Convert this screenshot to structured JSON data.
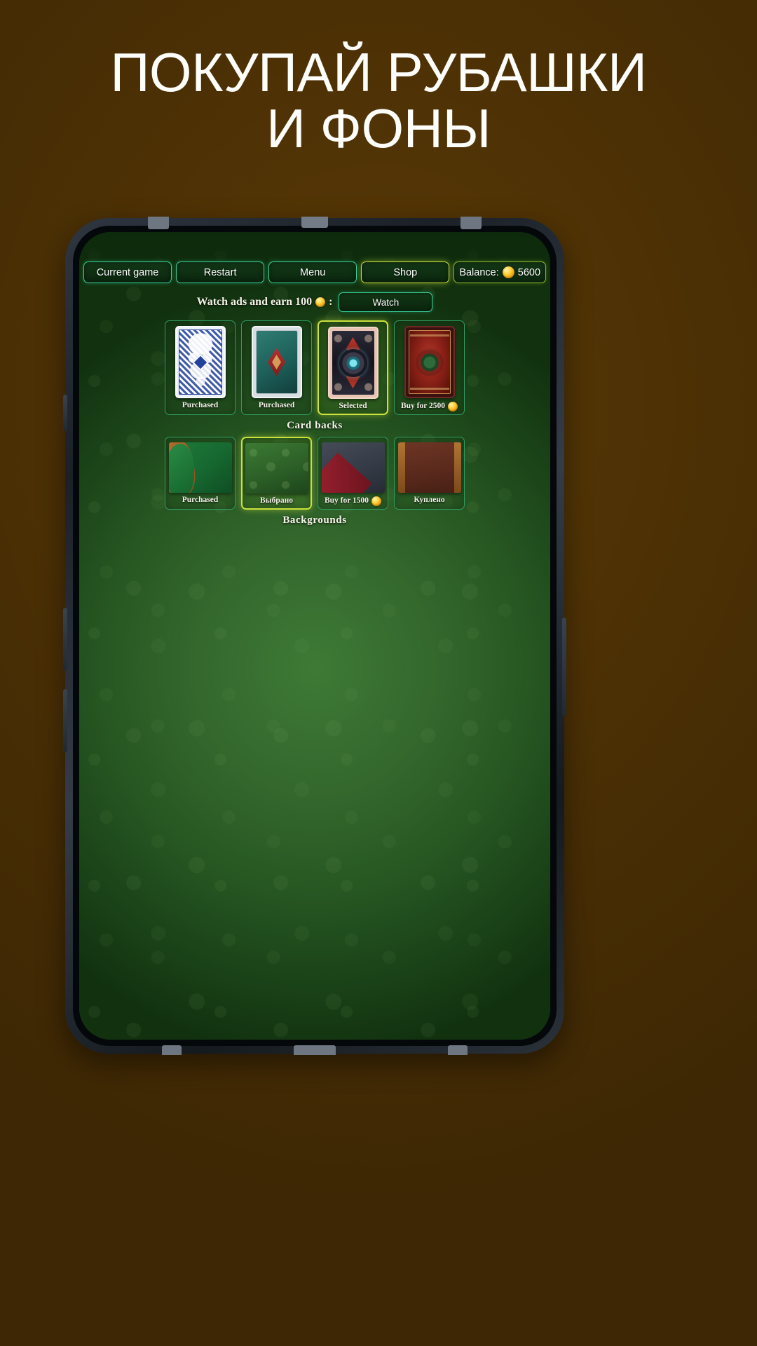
{
  "promo": {
    "headline": "ПОКУПАЙ РУБАШКИ\nИ ФОНЫ",
    "bg_color": "#4a2f05",
    "headline_color": "#fdfdfa"
  },
  "toolbar": {
    "buttons": [
      {
        "label": "Current game",
        "active": false
      },
      {
        "label": "Restart",
        "active": false
      },
      {
        "label": "Menu",
        "active": false
      },
      {
        "label": "Shop",
        "active": true
      }
    ],
    "balance_label": "Balance:",
    "balance_value": "5600",
    "coin_icon": "coin-icon",
    "accent_green": "#36d29a",
    "accent_yellow": "#c9e23c"
  },
  "ads": {
    "text_before": "Watch ads and earn 100",
    "text_after": ":",
    "watch_button": "Watch"
  },
  "sections": [
    {
      "id": "card-backs",
      "title": "Card backs",
      "items": [
        {
          "label": "Purchased",
          "state": "purchased",
          "has_coin": false,
          "art": "cb-blue"
        },
        {
          "label": "Purchased",
          "state": "purchased",
          "has_coin": false,
          "art": "cb-teal"
        },
        {
          "label": "Selected",
          "state": "selected",
          "has_coin": false,
          "art": "cb-orn"
        },
        {
          "label": "Buy for 2500",
          "state": "buy",
          "has_coin": true,
          "art": "cb-red"
        }
      ]
    },
    {
      "id": "backgrounds",
      "title": "Backgrounds",
      "items": [
        {
          "label": "Purchased",
          "state": "purchased",
          "has_coin": false,
          "art": "bga-1"
        },
        {
          "label": "Выбрано",
          "state": "selected",
          "has_coin": false,
          "art": "bga-2"
        },
        {
          "label": "Buy for 1500",
          "state": "buy",
          "has_coin": true,
          "art": "bga-3"
        },
        {
          "label": "Куплено",
          "state": "purchased",
          "has_coin": false,
          "art": "bga-4"
        }
      ]
    }
  ]
}
